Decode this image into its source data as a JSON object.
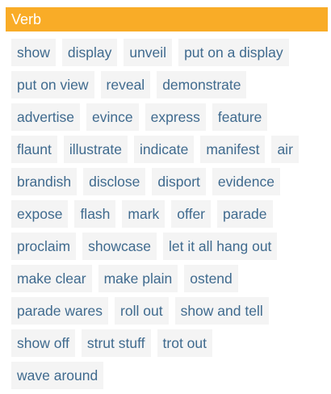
{
  "header": {
    "title": "Verb"
  },
  "rows": [
    [
      "show",
      "display",
      "unveil",
      "put on a display"
    ],
    [
      "put on view",
      "reveal",
      "demonstrate"
    ],
    [
      "advertise",
      "evince",
      "express",
      "feature"
    ],
    [
      "flaunt",
      "illustrate",
      "indicate",
      "manifest",
      "air"
    ],
    [
      "brandish",
      "disclose",
      "disport",
      "evidence"
    ],
    [
      "expose",
      "flash",
      "mark",
      "offer",
      "parade"
    ],
    [
      "proclaim",
      "showcase",
      "let it all hang out"
    ],
    [
      "make clear",
      "make plain",
      "ostend"
    ],
    [
      "parade wares",
      "roll out",
      "show and tell"
    ],
    [
      "show off",
      "strut stuff",
      "trot out"
    ],
    [
      "wave around"
    ]
  ],
  "colors": {
    "header_background": "#f9ac27",
    "header_text": "#ffffff",
    "chip_background": "#f4f4f4",
    "chip_text": "#3f6a8e"
  }
}
